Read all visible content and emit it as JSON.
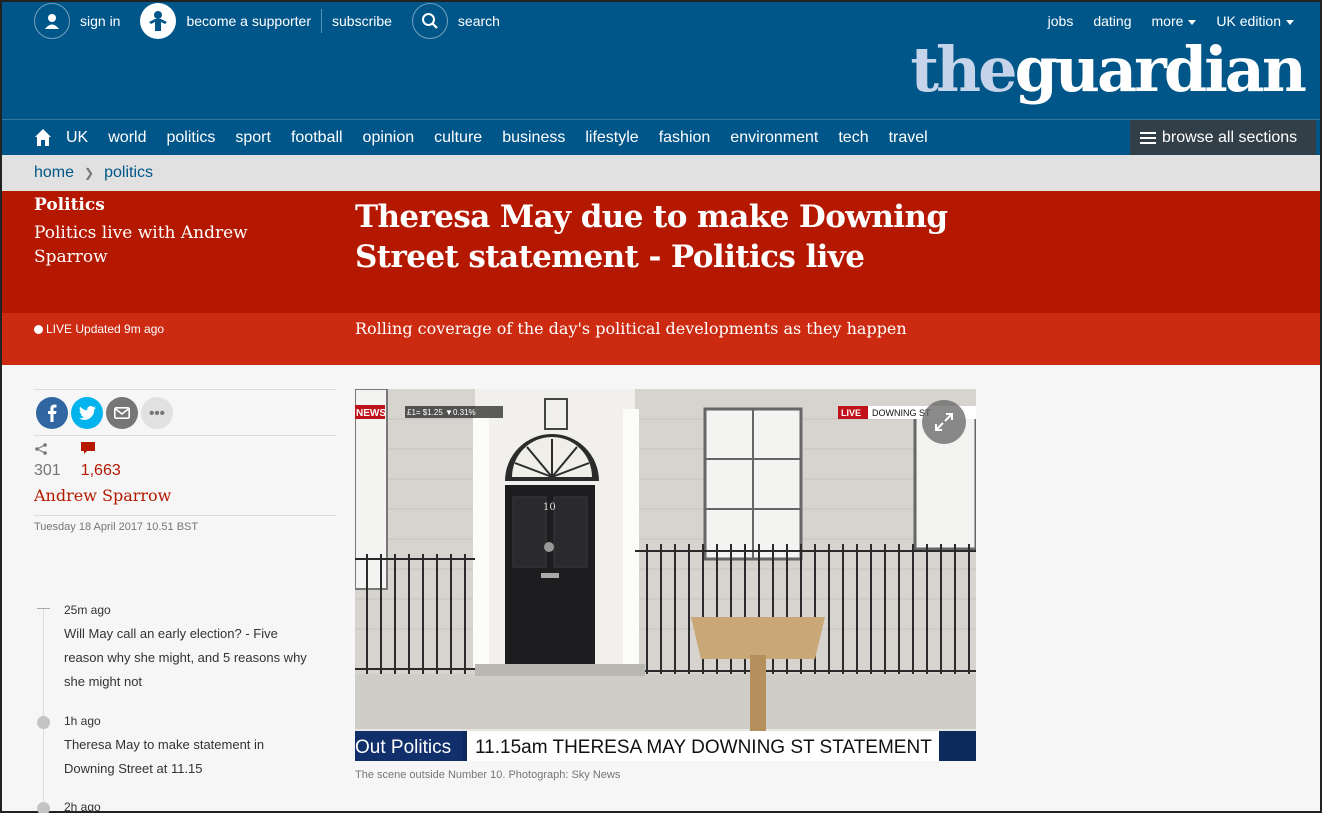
{
  "header": {
    "sign_in": "sign in",
    "become_supporter": "become a supporter",
    "subscribe": "subscribe",
    "search": "search",
    "jobs": "jobs",
    "dating": "dating",
    "more": "more",
    "edition": "UK edition",
    "logo_part1": "the",
    "logo_part2": "guardian"
  },
  "nav": {
    "items": [
      "UK",
      "world",
      "politics",
      "sport",
      "football",
      "opinion",
      "culture",
      "business",
      "lifestyle",
      "fashion",
      "environment",
      "tech",
      "travel"
    ],
    "browse": "browse all sections"
  },
  "breadcrumb": {
    "home": "home",
    "section": "politics"
  },
  "article": {
    "section": "Politics",
    "series": "Politics live with Andrew Sparrow",
    "headline": "Theresa May due to make Downing Street statement - Politics live",
    "live_status": "LIVE Updated 9m ago",
    "standfirst": "Rolling coverage of the day's political developments as they happen",
    "share_count": "301",
    "comment_count": "1,663",
    "byline": "Andrew Sparrow",
    "date": "Tuesday 18 April 2017 10.51 BST",
    "caption": "The scene outside Number 10. Photograph: Sky News"
  },
  "media": {
    "ticker_left": "Out Politics",
    "ticker_main": "11.15am THERESA MAY DOWNING ST STATEMENT",
    "live_tag": "LIVE",
    "location_tag": "DOWNING ST",
    "news_tag": "NEWS",
    "fx_tag": "£1= $1.25 ▼0.31%",
    "door_number": "10"
  },
  "timeline": [
    {
      "time": "25m ago",
      "text": "Will May call an early election? - Five reason why she might, and 5 reasons why she might not"
    },
    {
      "time": "1h ago",
      "text": "Theresa May to make statement in Downing Street at 11.15"
    },
    {
      "time": "2h ago",
      "text": ""
    }
  ],
  "colors": {
    "header_blue": "#005689",
    "headline_red": "#b51800",
    "standfirst_red": "#cc2b12"
  },
  "icons": [
    "user-icon",
    "supporter-icon",
    "search-icon",
    "home-icon",
    "menu-icon",
    "facebook-icon",
    "twitter-icon",
    "email-icon",
    "more-icon",
    "share-icon",
    "comment-icon",
    "expand-icon"
  ]
}
